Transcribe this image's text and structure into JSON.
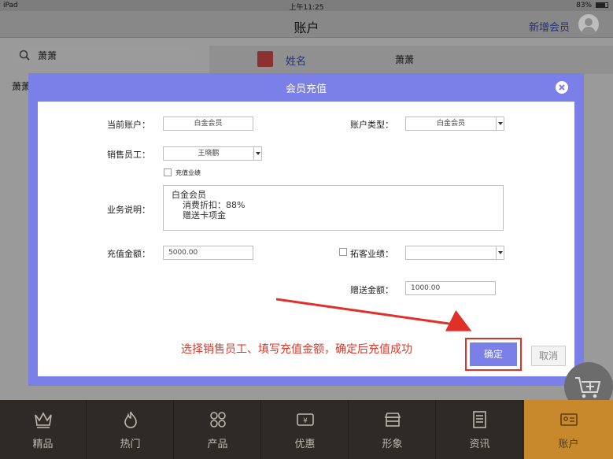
{
  "status_bar": {
    "device": "iPad",
    "time": "上午11:25",
    "battery": "83%"
  },
  "nav": {
    "title": "账户",
    "add_member": "新增会员"
  },
  "background": {
    "search_value": "萧萧",
    "list_item_name": "萧萧",
    "detail_label": "姓名",
    "detail_value": "萧萧"
  },
  "dialog": {
    "title": "会员充值",
    "current_account_label": "当前账户：",
    "current_account_value": "白金会员",
    "account_type_label": "账户类型：",
    "account_type_value": "白金会员",
    "sales_staff_label": "销售员工：",
    "sales_staff_value": "王晓鹏",
    "recharge_performance_label": "充值业绩",
    "business_desc_label": "业务说明：",
    "business_desc_line1": "白金会员",
    "business_desc_line2": "消费折扣：88%",
    "business_desc_line3": "赠送卡项金",
    "recharge_amount_label": "充值金额：",
    "recharge_amount_value": "5000.00",
    "expansion_performance_label": "拓客业绩：",
    "expansion_performance_value": "",
    "gift_amount_label": "赠送金额：",
    "gift_amount_value": "1000.00",
    "confirm_label": "确定",
    "cancel_label": "取消"
  },
  "annotation": {
    "text": "选择销售员工、填写充值金额，确定后充值成功",
    "color": "#e0302a"
  },
  "tabs": [
    {
      "label": "精品",
      "icon": "crown-icon"
    },
    {
      "label": "热门",
      "icon": "flame-icon"
    },
    {
      "label": "产品",
      "icon": "grid-icon"
    },
    {
      "label": "优惠",
      "icon": "ticket-icon"
    },
    {
      "label": "形象",
      "icon": "store-icon"
    },
    {
      "label": "资讯",
      "icon": "news-icon"
    },
    {
      "label": "账户",
      "icon": "account-card-icon",
      "active": true
    }
  ],
  "colors": {
    "dialog_header": "#7a80e8",
    "tab_bar": "#2f2a25",
    "tab_active": "#c7892c"
  }
}
